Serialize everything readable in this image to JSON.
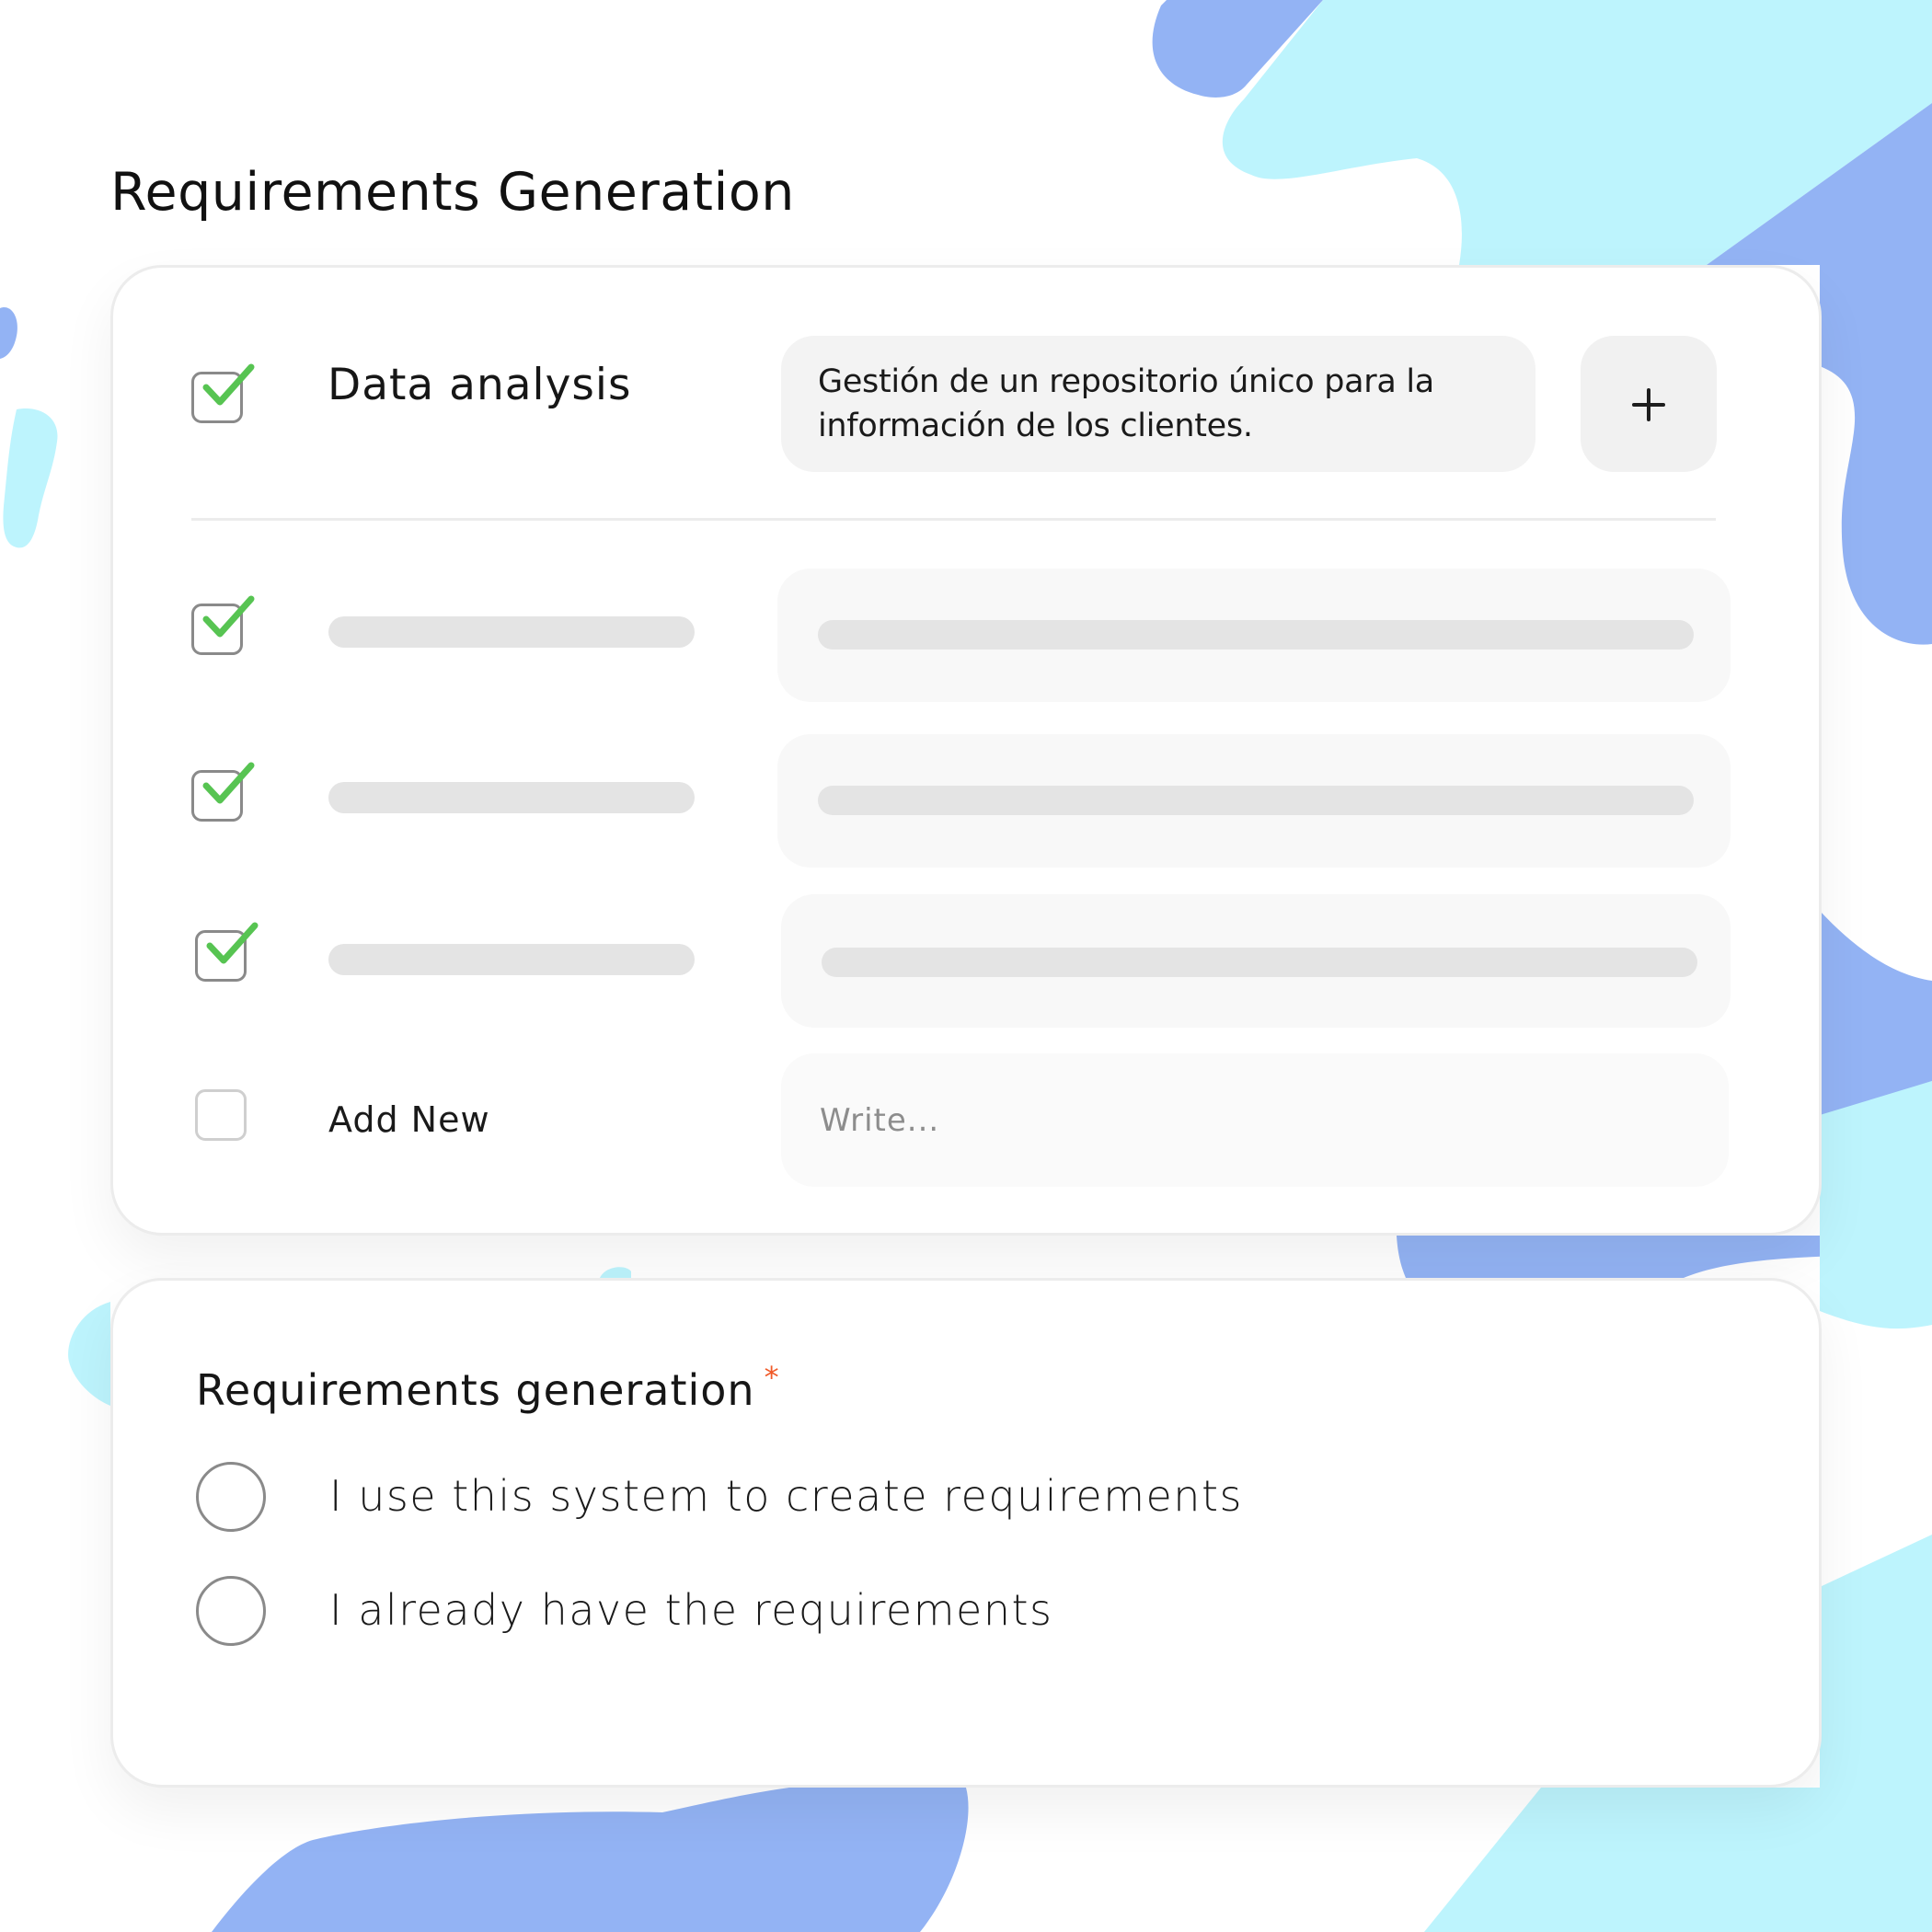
{
  "colors": {
    "accent_blue": "#93b3f4",
    "accent_cyan": "#bdf4fd",
    "check_green": "#57c452",
    "required_orange": "#f05a28"
  },
  "page": {
    "title": "Requirements Generation"
  },
  "requirements": {
    "first": {
      "checked": true,
      "title": "Data analysis",
      "description": "Gestión de un repositorio único para la información de los clientes.",
      "add_icon": "plus-icon"
    },
    "placeholder_rows": [
      {
        "checked": true
      },
      {
        "checked": true
      },
      {
        "checked": true
      }
    ],
    "add_new": {
      "checked": false,
      "label": "Add New",
      "placeholder": "Write..."
    }
  },
  "question": {
    "label": "Requirements generation",
    "required_mark": "*",
    "options": [
      {
        "label": "I use this system to create requirements",
        "selected": false
      },
      {
        "label": "I already have the requirements",
        "selected": false
      }
    ]
  }
}
